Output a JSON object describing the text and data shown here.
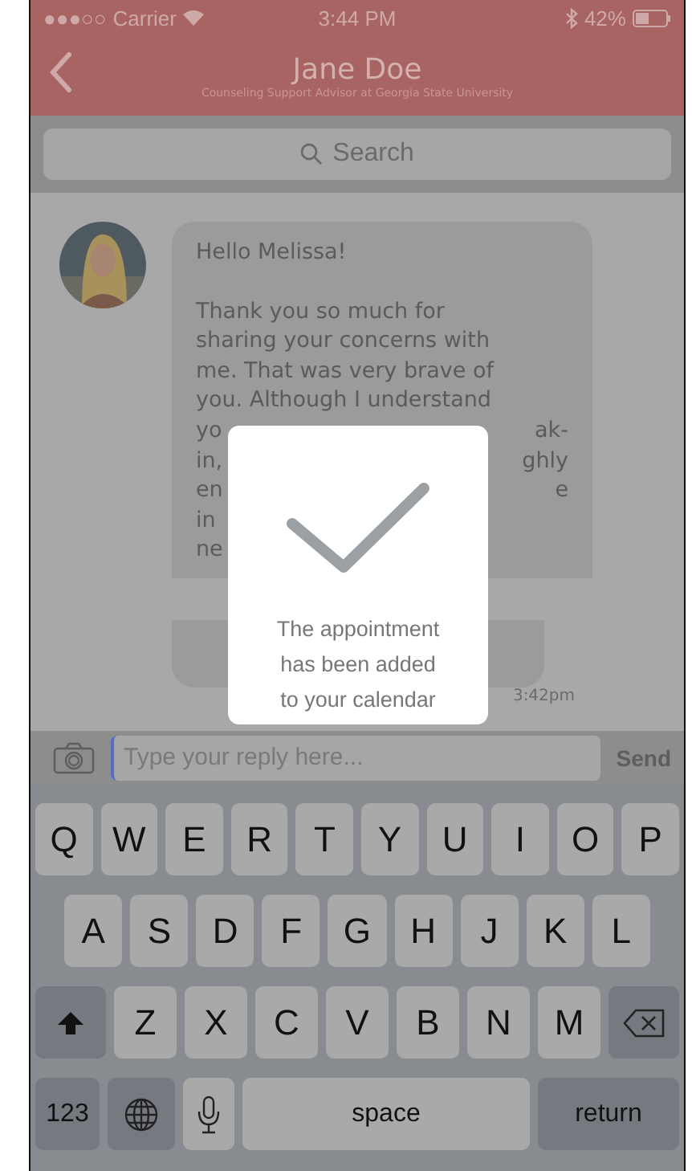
{
  "status_bar": {
    "signal": "●●●○○",
    "carrier": "Carrier",
    "time": "3:44 PM",
    "battery": "42%"
  },
  "header": {
    "name": "Jane Doe",
    "subtitle": "Counseling Support Advisor at Georgia State University"
  },
  "search": {
    "placeholder": "Search"
  },
  "message": {
    "greeting": "Hello Melissa!",
    "lines": [
      {
        "left": "Thank you so much for"
      },
      {
        "left": "sharing your concerns with"
      },
      {
        "left": "me. That was very brave of"
      },
      {
        "left": "you. Although I understand"
      },
      {
        "left": "yo",
        "right": "ak-"
      },
      {
        "left": "in,",
        "right": "ghly"
      },
      {
        "left": "en",
        "right": "e"
      },
      {
        "left": "in"
      },
      {
        "left": "ne"
      }
    ],
    "time": "3:42pm"
  },
  "dialog": {
    "lines": [
      "The appointment",
      "has been added",
      "to your calendar"
    ]
  },
  "composer": {
    "placeholder": "Type your reply here...",
    "send": "Send"
  },
  "keyboard": {
    "top_row": [
      {
        "kind": "letter",
        "label": "Q"
      },
      {
        "kind": "letter",
        "label": "W"
      },
      {
        "kind": "letter",
        "label": "E"
      },
      {
        "kind": "letter",
        "label": "R"
      },
      {
        "kind": "letter",
        "label": "T"
      },
      {
        "kind": "letter",
        "label": "Y"
      },
      {
        "kind": "letter",
        "label": "U"
      },
      {
        "kind": "letter",
        "label": "I"
      },
      {
        "kind": "letter",
        "label": "O"
      },
      {
        "kind": "letter",
        "label": "P"
      }
    ],
    "middle_row": [
      {
        "kind": "letter",
        "label": "A"
      },
      {
        "kind": "letter",
        "label": "S"
      },
      {
        "kind": "letter",
        "label": "D"
      },
      {
        "kind": "letter",
        "label": "F"
      },
      {
        "kind": "letter",
        "label": "G"
      },
      {
        "kind": "letter",
        "label": "H"
      },
      {
        "kind": "letter",
        "label": "J"
      },
      {
        "kind": "letter",
        "label": "K"
      },
      {
        "kind": "letter",
        "label": "L"
      }
    ],
    "lower_row": [
      {
        "kind": "shift"
      },
      {
        "kind": "letter",
        "label": "Z"
      },
      {
        "kind": "letter",
        "label": "X"
      },
      {
        "kind": "letter",
        "label": "C"
      },
      {
        "kind": "letter",
        "label": "V"
      },
      {
        "kind": "letter",
        "label": "B"
      },
      {
        "kind": "letter",
        "label": "N"
      },
      {
        "kind": "letter",
        "label": "M"
      },
      {
        "kind": "delete"
      }
    ],
    "function_row": [
      {
        "kind": "mode",
        "label": "123"
      },
      {
        "kind": "globe"
      },
      {
        "kind": "mic"
      },
      {
        "kind": "space",
        "label": "space"
      },
      {
        "kind": "return",
        "label": "return"
      }
    ]
  }
}
